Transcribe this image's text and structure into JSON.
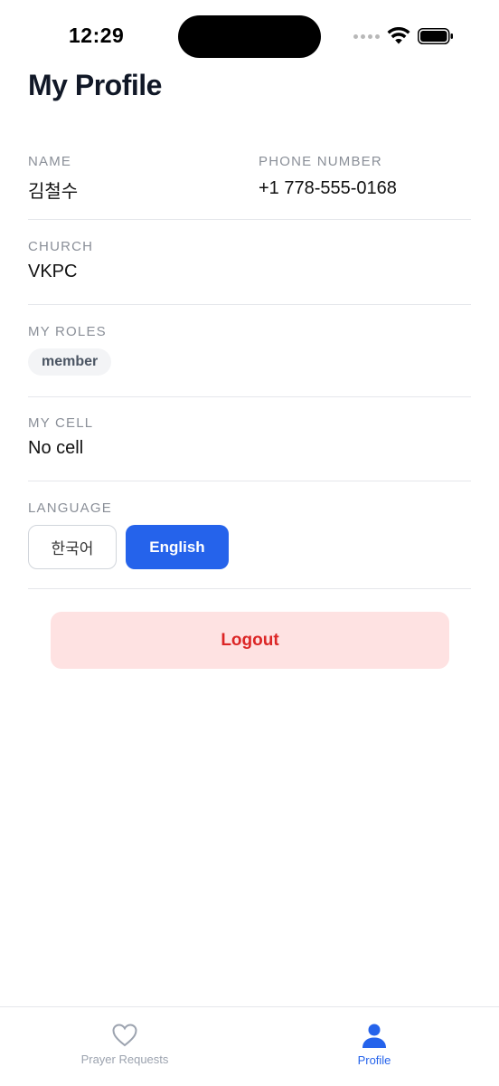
{
  "status_bar": {
    "time": "12:29",
    "icons": [
      "signal-dots-icon",
      "wifi-icon",
      "battery-icon"
    ]
  },
  "header": {
    "title": "My Profile"
  },
  "profile": {
    "name": {
      "label": "NAME",
      "value": "김철수"
    },
    "phone": {
      "label": "PHONE NUMBER",
      "value": "+1 778-555-0168"
    },
    "church": {
      "label": "CHURCH",
      "value": "VKPC"
    },
    "roles": {
      "label": "MY ROLES",
      "items": [
        "member"
      ]
    },
    "cell": {
      "label": "MY CELL",
      "value": "No cell"
    },
    "language": {
      "label": "LANGUAGE",
      "options": [
        "한국어",
        "English"
      ],
      "selected": "English"
    }
  },
  "actions": {
    "logout_label": "Logout"
  },
  "tab_bar": {
    "tabs": [
      {
        "label": "Prayer Requests",
        "icon": "heart-icon",
        "active": false
      },
      {
        "label": "Profile",
        "icon": "person-icon",
        "active": true
      }
    ]
  },
  "colors": {
    "accent": "#2563eb",
    "logout_bg": "#fee2e2",
    "logout_text": "#dc2626",
    "label_gray": "#8a8f98"
  }
}
